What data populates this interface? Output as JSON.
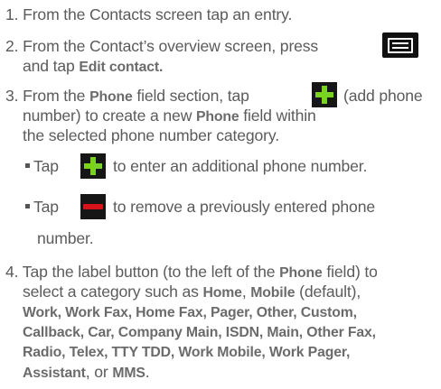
{
  "steps": {
    "s1": {
      "num": "1.",
      "text": "From the Contacts screen tap an entry."
    },
    "s2": {
      "num": "2.",
      "line1": "From the Contact’s overview screen, press",
      "line2_pre": "and tap ",
      "line2_bold": "Edit contact."
    },
    "s3": {
      "num": "3.",
      "line1_pre": "From the ",
      "line1_bold": "Phone",
      "line1_mid": " field section, tap",
      "line1_post": "(add phone",
      "line2_pre": "number) to create a new ",
      "line2_bold": "Phone",
      "line2_post": " field within",
      "line3": "the selected phone number category.",
      "bullet1_pre": "Tap",
      "bullet1_post": "to enter an additional phone number.",
      "bullet2_pre": "Tap",
      "bullet2_post": "to remove a previously entered phone",
      "bullet2_line2": "number."
    },
    "s4": {
      "num": "4.",
      "line1_pre": "Tap the label button (to the left of the ",
      "line1_bold": "Phone",
      "line1_post": " field) to",
      "line2_pre": "select a category such as ",
      "line2_b1": "Home",
      "line2_sep": ", ",
      "line2_b2": "Mobile",
      "line2_post": " (default),",
      "line3": "Work, Work Fax, Home Fax, Pager, Other, Custom,",
      "line4": "Callback, Car, Company Main, ISDN, Main, Other Fax,",
      "line5": "Radio, Telex, TTY TDD, Work Mobile, Work Pager,",
      "line6_b": "Assistant",
      "line6_mid": ", or ",
      "line6_b2": "MMS",
      "line6_end": "."
    }
  },
  "icons": {
    "menu": "menu-icon",
    "add": "plus-icon",
    "remove": "minus-icon"
  },
  "colors": {
    "body_text": "#5b5b5b",
    "add_green": "#7ad321",
    "remove_red": "#d8121b",
    "icon_bg": "#161616"
  }
}
